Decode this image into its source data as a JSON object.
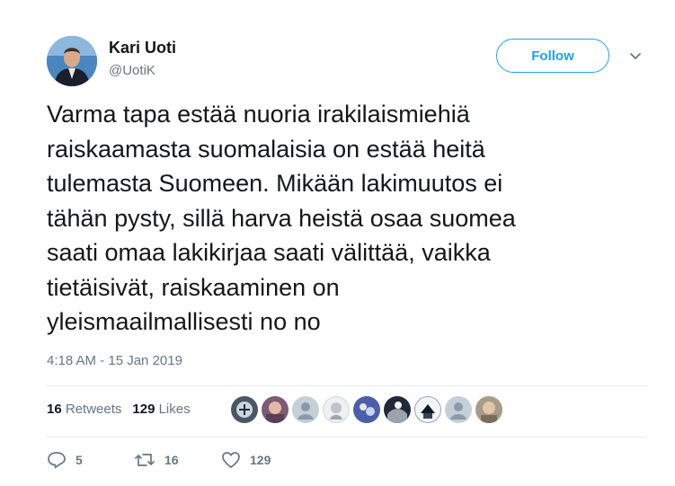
{
  "author": {
    "name": "Kari Uoti",
    "handle": "@UotiK"
  },
  "follow_label": "Follow",
  "tweet_text": "Varma tapa estää nuoria irakilaismiehiä\nraiskaamasta suomalaisia on estää heitä\ntulemasta Suomeen. Mikään lakimuutos ei\ntähän pysty, sillä harva heistä osaa suomea\nsaati omaa lakikirjaa saati välittää, vaikka\ntietäisivät, raiskaaminen on\nyleismaailmallisesti no no",
  "timestamp": "4:18 AM - 15 Jan 2019",
  "stats": {
    "retweets_count": "16",
    "retweets_label": "Retweets",
    "likes_count": "129",
    "likes_label": "Likes"
  },
  "actions": {
    "reply_count": "5",
    "retweet_count": "16",
    "like_count": "129"
  },
  "colors": {
    "accent": "#1da1f2",
    "text": "#14171a",
    "muted": "#657786"
  }
}
